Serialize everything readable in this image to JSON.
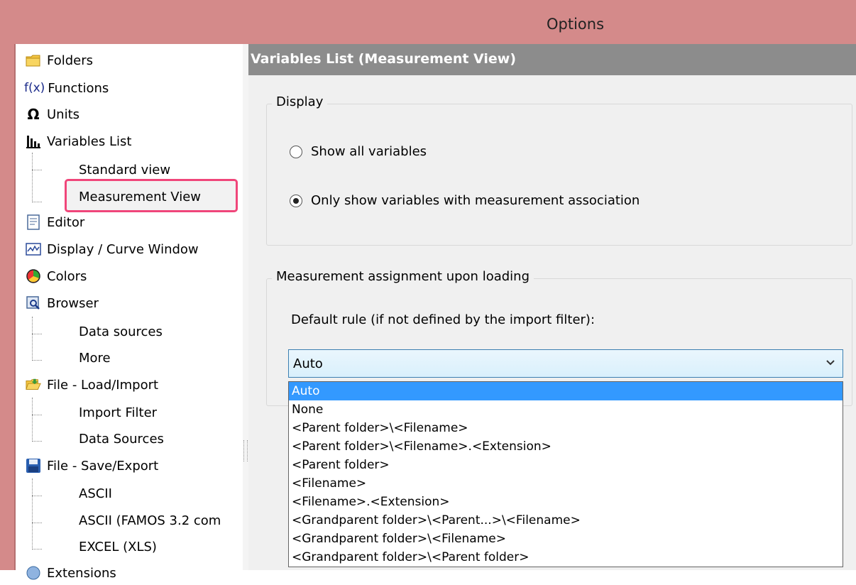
{
  "window": {
    "title": "Options"
  },
  "tree": {
    "items": [
      {
        "label": "Folders"
      },
      {
        "label": "Functions"
      },
      {
        "label": "Units"
      },
      {
        "label": "Variables List"
      },
      {
        "label": "Editor"
      },
      {
        "label": "Display / Curve Window"
      },
      {
        "label": "Colors"
      },
      {
        "label": "Browser"
      },
      {
        "label": "File - Load/Import"
      },
      {
        "label": "File - Save/Export"
      },
      {
        "label": "Extensions"
      }
    ],
    "children": {
      "variables": [
        "Standard view",
        "Measurement View"
      ],
      "browser": [
        "Data sources",
        "More"
      ],
      "load": [
        "Import Filter",
        "Data Sources"
      ],
      "save": [
        "ASCII",
        "ASCII (FAMOS 3.2 com",
        "EXCEL (XLS)"
      ]
    },
    "icon_fx": "f(x)",
    "icon_omega": "Ω"
  },
  "panel": {
    "header": "Variables List (Measurement View)",
    "display_group": {
      "legend": "Display",
      "options": [
        {
          "label": "Show all variables",
          "checked": false
        },
        {
          "label": "Only show variables with measurement association",
          "checked": true
        }
      ]
    },
    "assignment_group": {
      "legend": "Measurement assignment upon loading",
      "rule_label": "Default rule (if not defined by the import filter):",
      "selected": "Auto",
      "options": [
        "Auto",
        "None",
        "<Parent folder>\\<Filename>",
        "<Parent folder>\\<Filename>.<Extension>",
        "<Parent folder>",
        "<Filename>",
        "<Filename>.<Extension>",
        "<Grandparent folder>\\<Parent...>\\<Filename>",
        "<Grandparent folder>\\<Filename>",
        "<Grandparent folder>\\<Parent folder>"
      ]
    }
  },
  "colors": {
    "titlebar": "#d48a8a",
    "header": "#8c8c8c",
    "highlight": "#f0467a",
    "selection": "#3399ff"
  }
}
